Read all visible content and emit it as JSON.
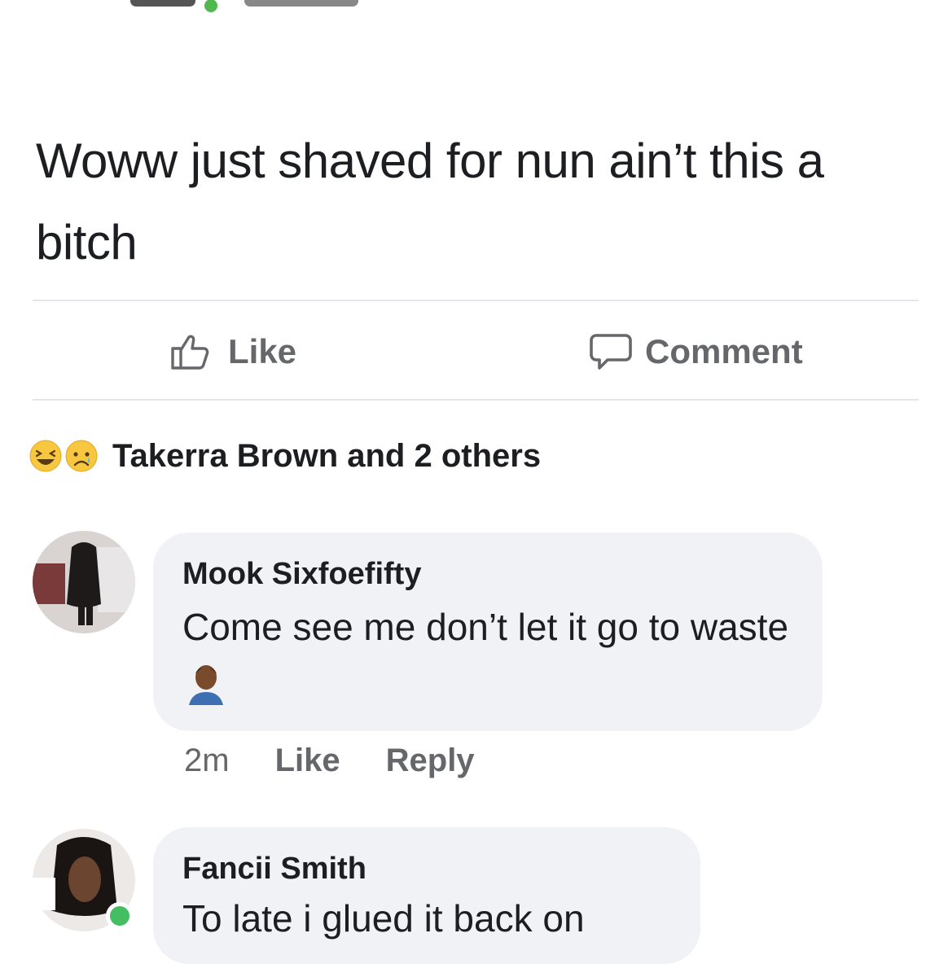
{
  "post": {
    "text": "Woww just shaved for nun ain’t this a bitch"
  },
  "actions": {
    "like_label": "Like",
    "comment_label": "Comment"
  },
  "reactions": {
    "summary": "Takerra Brown and 2 others",
    "emojis": [
      "laughing-emoji",
      "sad-emoji"
    ]
  },
  "comments": [
    {
      "author": "Mook Sixfoefifty",
      "text": "Come see me don’t let it go to waste",
      "time": "2m",
      "like_label": "Like",
      "reply_label": "Reply"
    },
    {
      "author": "Fancii Smith",
      "text": "To late i glued it back on"
    }
  ],
  "colors": {
    "bubble": "#f0f2f5",
    "meta_text": "#65676b",
    "online": "#45bd62"
  }
}
